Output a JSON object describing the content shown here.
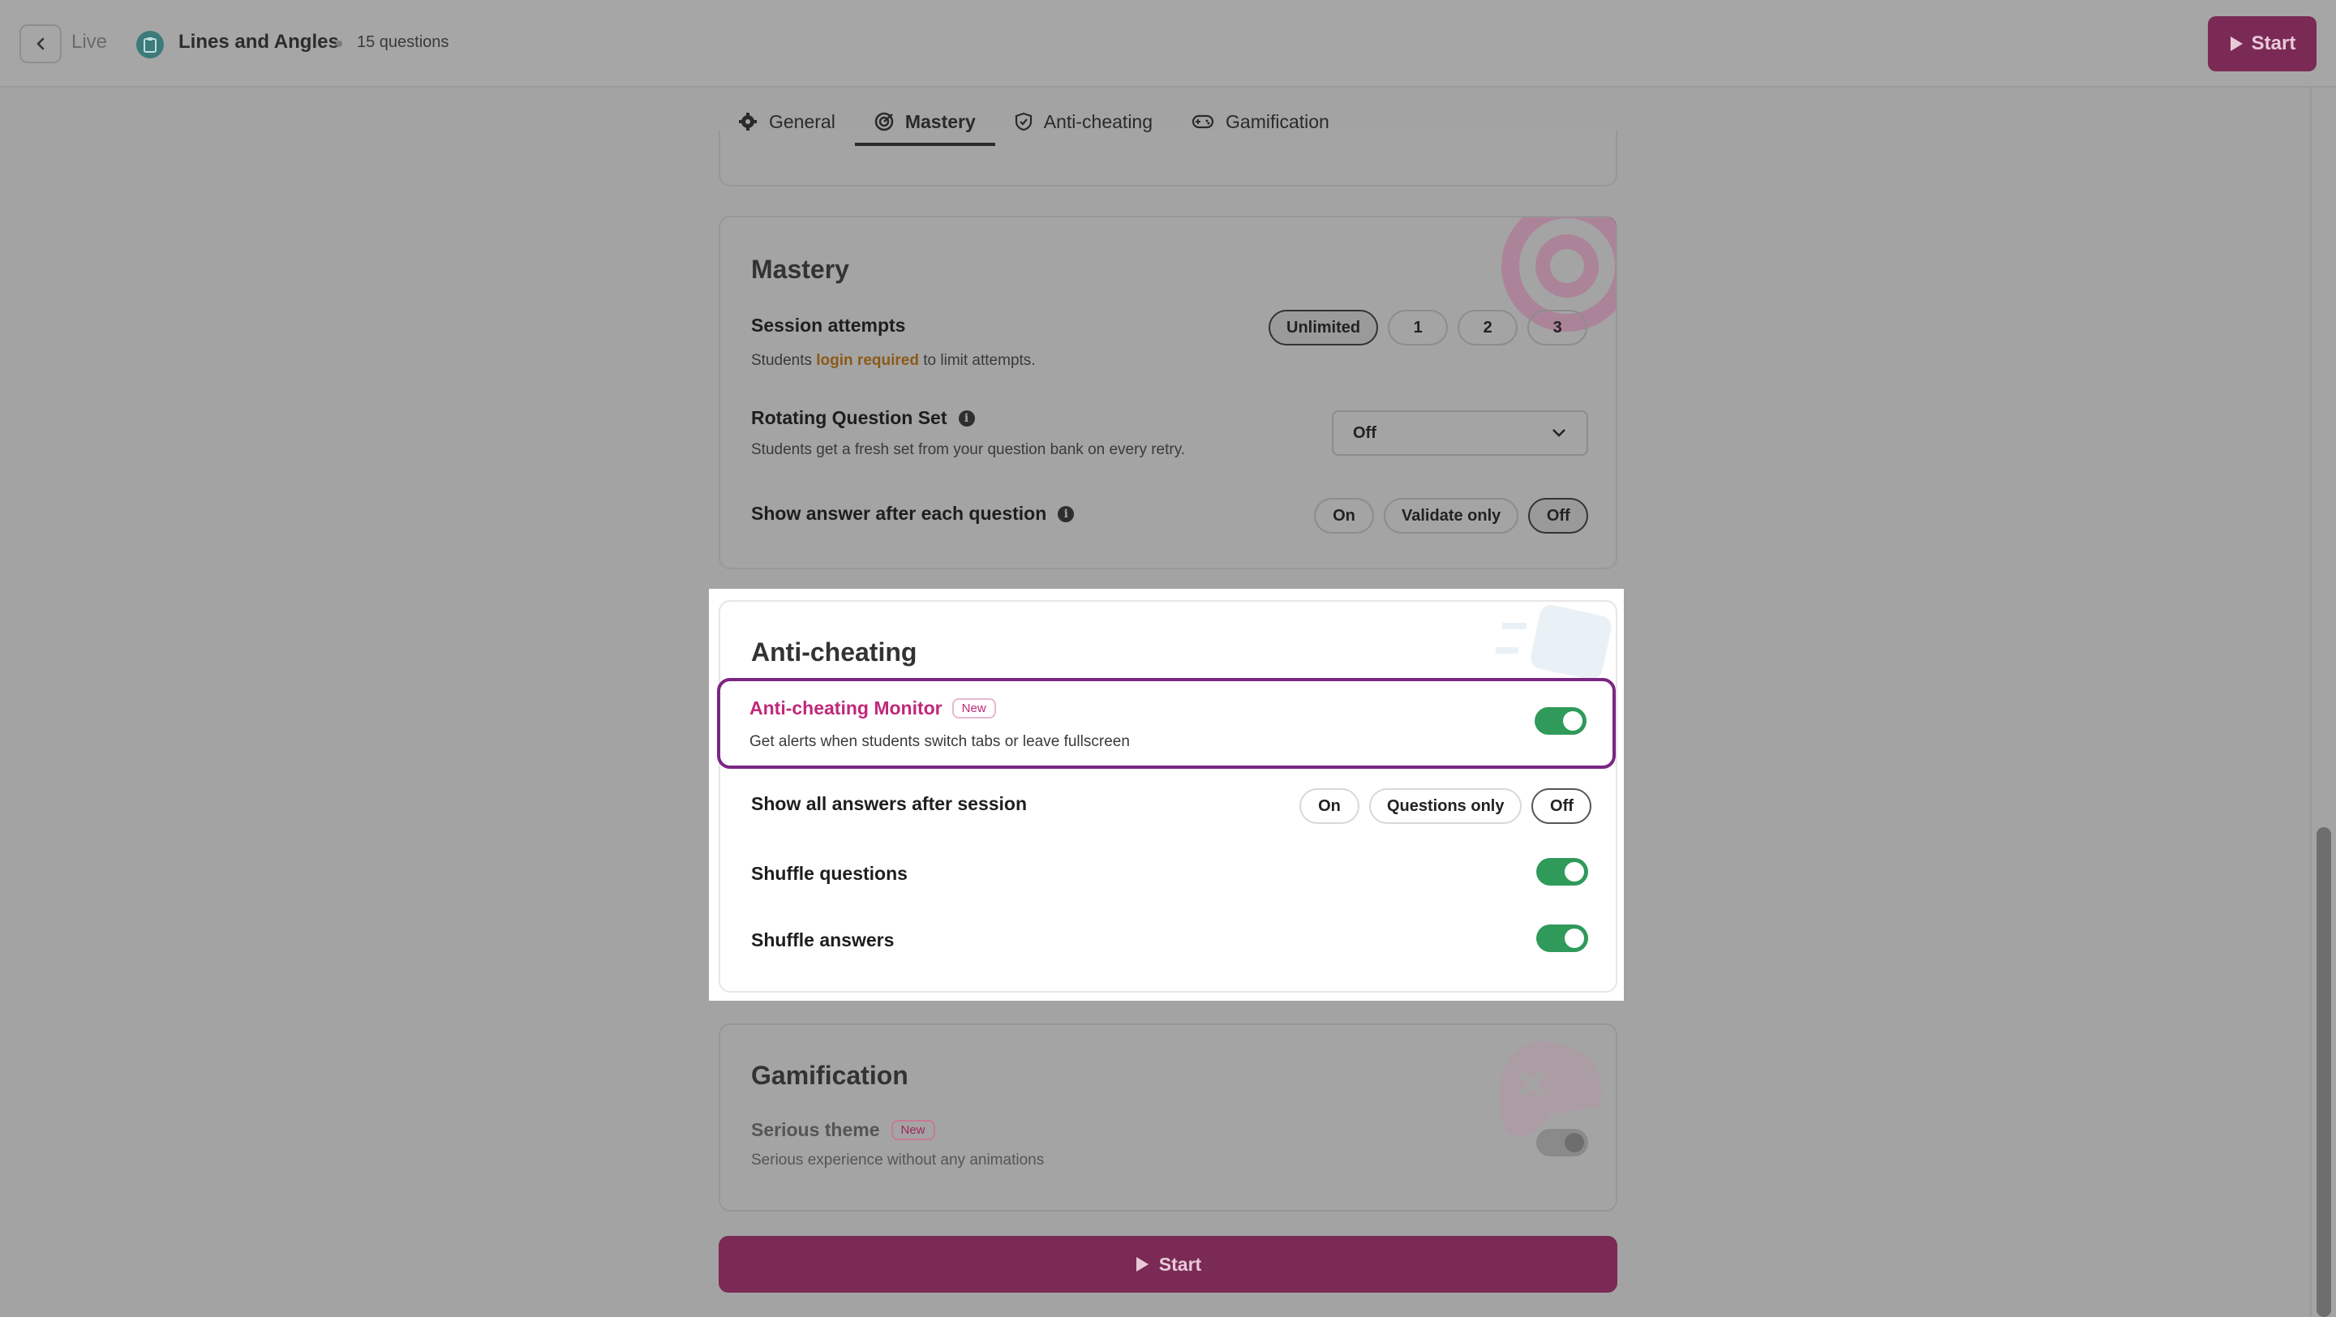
{
  "header": {
    "back_label": "Live",
    "title": "Lines and Angles",
    "question_count": "15 questions",
    "start_label": "Start"
  },
  "tabs": [
    {
      "label": "General",
      "icon": "gear-icon"
    },
    {
      "label": "Mastery",
      "icon": "target-icon",
      "active": true
    },
    {
      "label": "Anti-cheating",
      "icon": "shield-icon"
    },
    {
      "label": "Gamification",
      "icon": "gamepad-icon"
    }
  ],
  "mastery": {
    "title": "Mastery",
    "session_attempts": {
      "label": "Session attempts",
      "desc_prefix": "Students",
      "desc_link": "login required",
      "desc_suffix": "to limit attempts.",
      "options": [
        "Unlimited",
        "1",
        "2",
        "3"
      ],
      "selected": "Unlimited"
    },
    "rotating": {
      "label": "Rotating Question Set",
      "desc": "Students get a fresh set from your question bank on every retry.",
      "value": "Off"
    },
    "show_answer": {
      "label": "Show answer after each question",
      "options": [
        "On",
        "Validate only",
        "Off"
      ],
      "selected": "Off"
    }
  },
  "anti_cheating": {
    "title": "Anti-cheating",
    "monitor": {
      "label": "Anti-cheating Monitor",
      "badge": "New",
      "desc": "Get alerts when students switch tabs or leave fullscreen",
      "enabled": true
    },
    "show_all_answers": {
      "label": "Show all answers after session",
      "options": [
        "On",
        "Questions only",
        "Off"
      ],
      "selected": "Off"
    },
    "shuffle_questions": {
      "label": "Shuffle questions",
      "enabled": true
    },
    "shuffle_answers": {
      "label": "Shuffle answers",
      "enabled": true
    }
  },
  "gamification": {
    "title": "Gamification",
    "serious_theme": {
      "label": "Serious theme",
      "badge": "New",
      "desc": "Serious experience without any animations",
      "enabled": false
    }
  },
  "footer": {
    "start_label": "Start"
  },
  "colors": {
    "accent": "#c0287a",
    "start_button": "#7a2a55",
    "toggle_on": "#2f9a5a",
    "highlight_border": "#7b2683"
  }
}
